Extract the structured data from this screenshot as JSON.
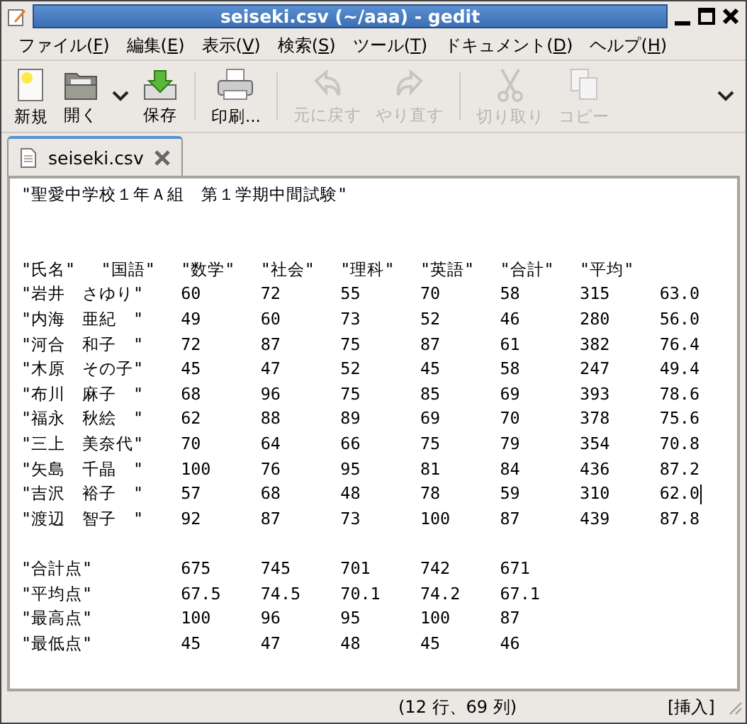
{
  "window": {
    "title": "seiseki.csv (~/aaa) - gedit"
  },
  "menu": [
    {
      "label": "ファイル(",
      "key": "F",
      "close": ")"
    },
    {
      "label": "編集(",
      "key": "E",
      "close": ")"
    },
    {
      "label": "表示(",
      "key": "V",
      "close": ")"
    },
    {
      "label": "検索(",
      "key": "S",
      "close": ")"
    },
    {
      "label": "ツール(",
      "key": "T",
      "close": ")"
    },
    {
      "label": "ドキュメント(",
      "key": "D",
      "close": ")"
    },
    {
      "label": "ヘルプ(",
      "key": "H",
      "close": ")"
    }
  ],
  "toolbar": [
    {
      "kind": "new",
      "label": "新規",
      "disabled": false
    },
    {
      "kind": "open",
      "label": "開く",
      "disabled": false
    },
    {
      "kind": "dropdown"
    },
    {
      "kind": "save",
      "label": "保存",
      "disabled": false
    },
    {
      "kind": "separator"
    },
    {
      "kind": "print",
      "label": "印刷...",
      "disabled": false
    },
    {
      "kind": "separator"
    },
    {
      "kind": "undo",
      "label": "元に戻す",
      "disabled": true
    },
    {
      "kind": "redo",
      "label": "やり直す",
      "disabled": true
    },
    {
      "kind": "separator"
    },
    {
      "kind": "cut",
      "label": "切り取り",
      "disabled": true
    },
    {
      "kind": "copy",
      "label": "コピー",
      "disabled": true
    }
  ],
  "tabs": [
    {
      "label": "seiseki.csv",
      "selected": true
    }
  ],
  "editor": {
    "lines": [
      {
        "kind": "text",
        "text": "\"聖愛中学校１年Ａ組　第１学期中間試験\"",
        "cursor": false
      },
      {
        "kind": "blank"
      },
      {
        "kind": "blank"
      },
      {
        "kind": "text",
        "text": "\"氏名\"\t\"国語\"\t\"数学\"\t\"社会\"\t\"理科\"\t\"英語\"\t\"合計\"\t\"平均\"",
        "cursor": false
      },
      {
        "kind": "text",
        "text": "\"岩井　さゆり\"\t60\t72\t55\t70\t58\t315\t63.0",
        "cursor": false
      },
      {
        "kind": "text",
        "text": "\"内海　亜紀　\"\t49\t60\t73\t52\t46\t280\t56.0",
        "cursor": false
      },
      {
        "kind": "text",
        "text": "\"河合　和子　\"\t72\t87\t75\t87\t61\t382\t76.4",
        "cursor": false
      },
      {
        "kind": "text",
        "text": "\"木原　その子\"\t45\t47\t52\t45\t58\t247\t49.4",
        "cursor": false
      },
      {
        "kind": "text",
        "text": "\"布川　麻子　\"\t68\t96\t75\t85\t69\t393\t78.6",
        "cursor": false
      },
      {
        "kind": "text",
        "text": "\"福永　秋絵　\"\t62\t88\t89\t69\t70\t378\t75.6",
        "cursor": false
      },
      {
        "kind": "text",
        "text": "\"三上　美奈代\"\t70\t64\t66\t75\t79\t354\t70.8",
        "cursor": false
      },
      {
        "kind": "text",
        "text": "\"矢島　千晶　\"\t100\t76\t95\t81\t84\t436\t87.2",
        "cursor": false
      },
      {
        "kind": "text",
        "text": "\"吉沢　裕子　\"\t57\t68\t48\t78\t59\t310\t62.0",
        "cursor": true
      },
      {
        "kind": "text",
        "text": "\"渡辺　智子　\"\t92\t87\t73\t100\t87\t439\t87.8",
        "cursor": false
      },
      {
        "kind": "blank"
      },
      {
        "kind": "text",
        "text": "\"合計点\"\t\t675\t745\t701\t742\t671",
        "cursor": false
      },
      {
        "kind": "text",
        "text": "\"平均点\"\t\t67.5\t74.5\t70.1\t74.2\t67.1",
        "cursor": false
      },
      {
        "kind": "text",
        "text": "\"最高点\"\t\t100\t96\t95\t100\t87",
        "cursor": false
      },
      {
        "kind": "text",
        "text": "\"最低点\"\t\t45\t47\t48\t45\t46",
        "cursor": false
      }
    ]
  },
  "status_bar": {
    "position": "(12 行、69 列)",
    "mode": "[挿入]"
  }
}
